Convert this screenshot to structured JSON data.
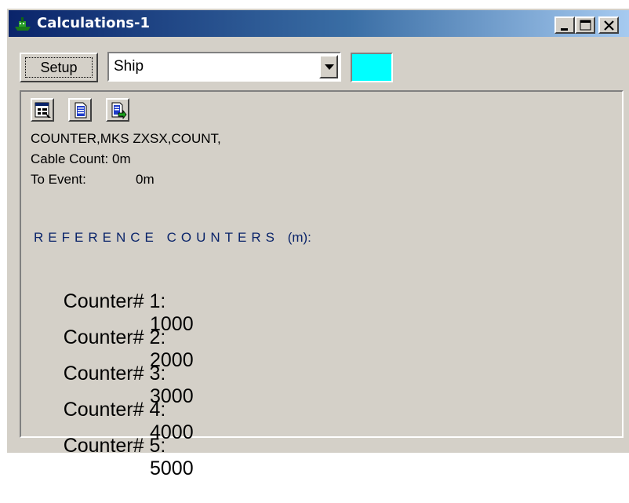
{
  "window": {
    "title": "Calculations-1",
    "app_icon": "ship-icon",
    "controls": [
      "minimize-icon",
      "maximize-icon",
      "close-icon"
    ]
  },
  "toolbar": {
    "setup_label": "Setup",
    "select_value": "Ship",
    "color_swatch": "#00ffff"
  },
  "panel": {
    "tool_icons": [
      "properties-icon",
      "document-icon",
      "export-icon"
    ],
    "status_line": "COUNTER,MKS ZXSX,COUNT,",
    "cable_count_label": "Cable Count:",
    "cable_count_value": "0m",
    "to_event_label": "To Event:",
    "to_event_value": "0m",
    "reference_heading": "REFERENCE COUNTERS",
    "reference_unit": "(m):",
    "counters": [
      {
        "label": "Counter# 1:",
        "value": "1000"
      },
      {
        "label": "Counter# 2:",
        "value": "2000"
      },
      {
        "label": "Counter# 3:",
        "value": "3000"
      },
      {
        "label": "Counter# 4:",
        "value": "4000"
      },
      {
        "label": "Counter# 5:",
        "value": "5000"
      }
    ]
  }
}
